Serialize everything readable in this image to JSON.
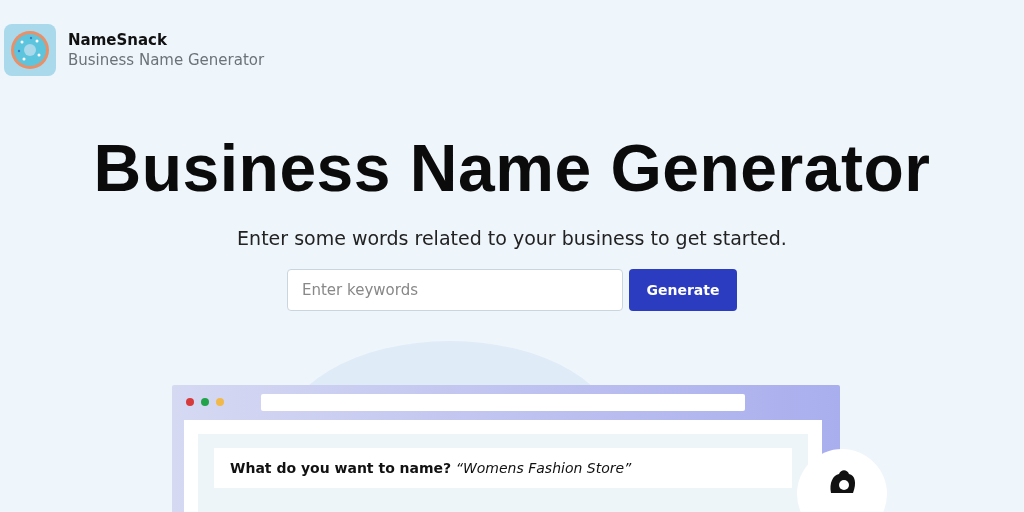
{
  "header": {
    "brand": "NameSnack",
    "tagline": "Business Name Generator"
  },
  "hero": {
    "title": "Business Name Generator",
    "subtitle": "Enter some words related to your business to get started."
  },
  "search": {
    "placeholder": "Enter keywords",
    "button": "Generate"
  },
  "preview": {
    "question": "**What do you want to name?** *“Womens Fashion Store”*"
  }
}
